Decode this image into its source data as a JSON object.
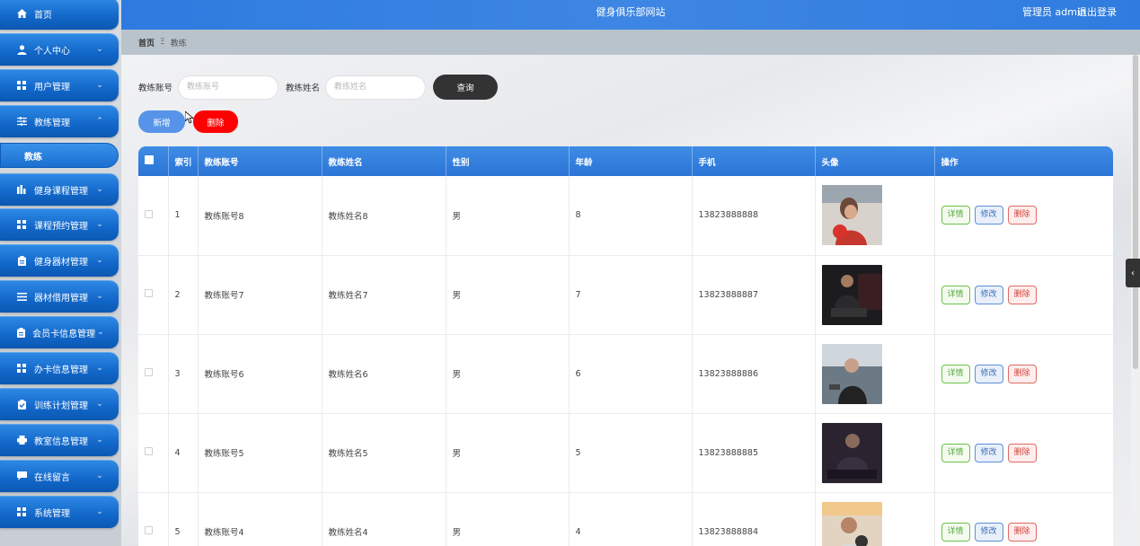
{
  "header": {
    "site_title": "健身俱乐部网站",
    "user_text": "管理员 admin",
    "logout_label": "退出登录"
  },
  "sidebar": {
    "items": [
      {
        "label": "首页",
        "icon": "home-icon"
      },
      {
        "label": "个人中心",
        "icon": "user-icon"
      },
      {
        "label": "用户管理",
        "icon": "grid-icon"
      },
      {
        "label": "教练管理",
        "icon": "sliders-icon"
      },
      {
        "label": "健身课程管理",
        "icon": "chart-icon"
      },
      {
        "label": "课程预约管理",
        "icon": "grid-icon"
      },
      {
        "label": "健身器材管理",
        "icon": "clipboard-icon"
      },
      {
        "label": "器材借用管理",
        "icon": "list-icon"
      },
      {
        "label": "会员卡信息管理",
        "icon": "clipboard-icon"
      },
      {
        "label": "办卡信息管理",
        "icon": "grid-icon"
      },
      {
        "label": "训练计划管理",
        "icon": "clipboard-check-icon"
      },
      {
        "label": "教室信息管理",
        "icon": "print-icon"
      },
      {
        "label": "在线留言",
        "icon": "message-icon"
      },
      {
        "label": "系统管理",
        "icon": "grid-icon"
      }
    ],
    "active_sub": "教练"
  },
  "breadcrumb": {
    "home": "首页",
    "separator": "Ξ",
    "current": "教练"
  },
  "filter": {
    "account_label": "教练账号",
    "account_placeholder": "教练账号",
    "name_label": "教练姓名",
    "name_placeholder": "教练姓名",
    "query_label": "查询"
  },
  "actions": {
    "add_label": "新增",
    "delete_label": "删除"
  },
  "table": {
    "headers": [
      "索引",
      "教练账号",
      "教练姓名",
      "性别",
      "年龄",
      "手机",
      "头像",
      "操作"
    ],
    "rows": [
      {
        "index": "1",
        "account": "教练账号8",
        "name": "教练姓名8",
        "gender": "男",
        "age": "8",
        "phone": "13823888888"
      },
      {
        "index": "2",
        "account": "教练账号7",
        "name": "教练姓名7",
        "gender": "男",
        "age": "7",
        "phone": "13823888887"
      },
      {
        "index": "3",
        "account": "教练账号6",
        "name": "教练姓名6",
        "gender": "男",
        "age": "6",
        "phone": "13823888886"
      },
      {
        "index": "4",
        "account": "教练账号5",
        "name": "教练姓名5",
        "gender": "男",
        "age": "5",
        "phone": "13823888885"
      },
      {
        "index": "5",
        "account": "教练账号4",
        "name": "教练姓名4",
        "gender": "男",
        "age": "4",
        "phone": "13823888884"
      }
    ],
    "op_labels": {
      "detail": "详情",
      "edit": "修改",
      "delete": "删除"
    }
  },
  "colors": {
    "accent": "#2d7be0",
    "danger": "#ff0000",
    "query_button": "#333333"
  }
}
